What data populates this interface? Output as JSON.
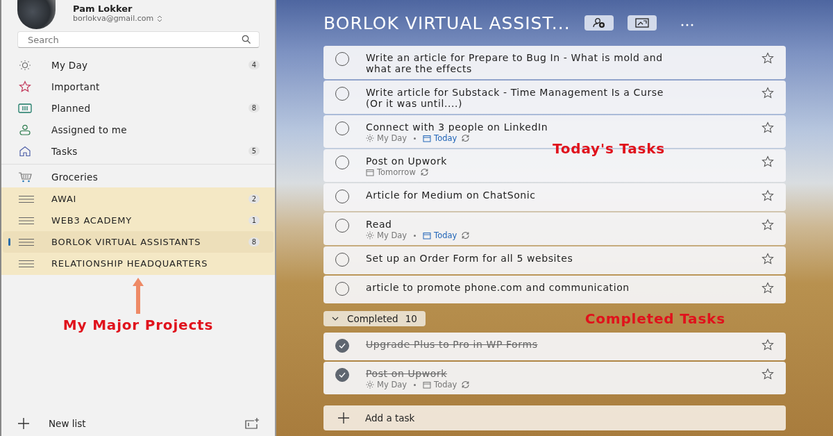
{
  "account": {
    "name": "Pam Lokker",
    "email": "borlokva@gmail.com"
  },
  "search": {
    "placeholder": "Search"
  },
  "smart_lists": [
    {
      "kind": "my_day",
      "label": "My Day",
      "count": "4",
      "selected": false
    },
    {
      "kind": "important",
      "label": "Important",
      "selected": false
    },
    {
      "kind": "planned",
      "label": "Planned",
      "count": "8",
      "selected": false
    },
    {
      "kind": "assigned",
      "label": "Assigned to me",
      "selected": false
    },
    {
      "kind": "tasks",
      "label": "Tasks",
      "count": "5",
      "selected": false
    }
  ],
  "lists": [
    {
      "kind": "groceries",
      "label": "Groceries",
      "selected": false
    }
  ],
  "project_lists": {
    "highlighted": true,
    "items": [
      {
        "label": "AWAI",
        "count": "2",
        "selected": false
      },
      {
        "label": "WEB3 ACADEMY",
        "count": "1",
        "selected": false
      },
      {
        "label": "BORLOK VIRTUAL ASSISTANTS",
        "count": "8",
        "selected": true
      },
      {
        "label": "RELATIONSHIP HEADQUARTERS",
        "selected": false
      }
    ]
  },
  "projects_annotation": "My Major Projects",
  "new_list": {
    "label": "New list"
  },
  "main": {
    "title": "BORLOK VIRTUAL ASSIST...",
    "tasks": [
      {
        "title": "Write an article for Prepare to Bug In - What is mold and what are the effects",
        "completed": false
      },
      {
        "title": "Write article for Substack - Time Management Is a Curse (Or it was until....)",
        "completed": false
      },
      {
        "title": "Connect with 3 people on LinkedIn",
        "completed": false,
        "meta": [
          {
            "kind": "my_day",
            "text": "My Day",
            "highlighted": false
          },
          {
            "kind": "due",
            "text": "Today",
            "highlighted": true
          }
        ],
        "repeat": true
      },
      {
        "title": "Post on Upwork",
        "completed": false,
        "meta": [
          {
            "kind": "due",
            "text": "Tomorrow",
            "highlighted": false
          }
        ],
        "repeat": true
      },
      {
        "title": "Article for Medium on ChatSonic",
        "completed": false
      },
      {
        "title": "Read",
        "completed": false,
        "meta": [
          {
            "kind": "my_day",
            "text": "My Day",
            "highlighted": false
          },
          {
            "kind": "due",
            "text": "Today",
            "highlighted": true
          }
        ],
        "repeat": true
      },
      {
        "title": "Set up an Order Form for all 5 websites",
        "completed": false
      },
      {
        "title": "article to promote phone.com and communication",
        "completed": false
      }
    ],
    "completed_group": {
      "label": "Completed",
      "count": "10",
      "expanded": true
    },
    "completed_tasks": [
      {
        "title": "Upgrade Plus to Pro in WP Forms",
        "completed": true
      },
      {
        "title": "Post on Upwork",
        "completed": true,
        "meta": [
          {
            "kind": "my_day",
            "text": "My Day",
            "highlighted": false
          },
          {
            "kind": "due",
            "text": "Today",
            "highlighted": false
          }
        ],
        "repeat": true
      }
    ],
    "add_task": {
      "label": "Add a task"
    },
    "annotations": [
      {
        "kind": "today",
        "text": "Today's Tasks"
      },
      {
        "kind": "completed",
        "text": "Completed Tasks"
      }
    ]
  }
}
